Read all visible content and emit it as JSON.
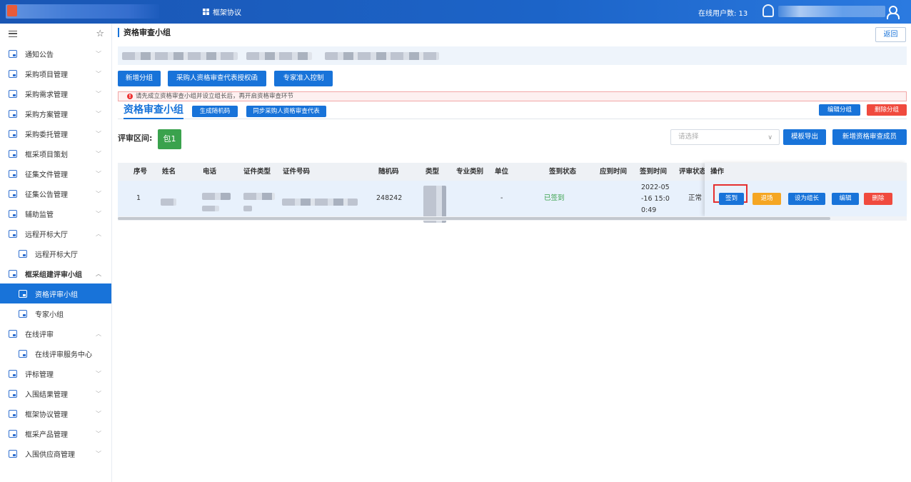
{
  "topbar": {
    "module_label": "框架协议",
    "online_users": "在线用户数: 13"
  },
  "sidebar": {
    "items": [
      {
        "label": "通知公告",
        "icon": "folder-icon",
        "chevron": "﹀"
      },
      {
        "label": "采购项目管理",
        "icon": "folder-icon",
        "chevron": "﹀"
      },
      {
        "label": "采购需求管理",
        "icon": "doc-icon",
        "chevron": "﹀"
      },
      {
        "label": "采购方案管理",
        "icon": "doc-icon",
        "chevron": "﹀"
      },
      {
        "label": "采购委托管理",
        "icon": "doc-icon",
        "chevron": "﹀"
      },
      {
        "label": "框采项目策划",
        "icon": "folder-icon",
        "chevron": "﹀"
      },
      {
        "label": "征集文件管理",
        "icon": "doc-icon",
        "chevron": "﹀"
      },
      {
        "label": "征集公告管理",
        "icon": "doc-icon",
        "chevron": "﹀"
      },
      {
        "label": "辅助监管",
        "icon": "monitor-icon",
        "chevron": "﹀"
      },
      {
        "label": "远程开标大厅",
        "icon": "doc-icon",
        "chevron": "︿"
      },
      {
        "label": "远程开标大厅",
        "icon": "doc-icon",
        "sub": true
      },
      {
        "label": "框采组建评审小组",
        "icon": "group-icon",
        "chevron": "︿",
        "bold": true
      },
      {
        "label": "资格评审小组",
        "icon": "group-icon",
        "sub": true,
        "active": true
      },
      {
        "label": "专家小组",
        "icon": "group-icon",
        "sub": true
      },
      {
        "label": "在线评审",
        "icon": "monitor-icon",
        "chevron": "︿"
      },
      {
        "label": "在线评审服务中心",
        "icon": "monitor-icon",
        "sub": true
      },
      {
        "label": "评标管理",
        "icon": "doc-icon",
        "chevron": "﹀"
      },
      {
        "label": "入围结果管理",
        "icon": "doc-icon",
        "chevron": "﹀"
      },
      {
        "label": "框架协议管理",
        "icon": "flow-icon",
        "chevron": "﹀"
      },
      {
        "label": "框采产品管理",
        "icon": "doc-icon",
        "chevron": "﹀"
      },
      {
        "label": "入围供应商管理",
        "icon": "doc-icon",
        "chevron": "﹀"
      }
    ]
  },
  "page": {
    "title": "资格审查小组",
    "back_label": "返回",
    "buttons": {
      "add_group": "新增分组",
      "authorize": "采购人资格审查代表授权函",
      "expert_access": "专家准入控制"
    },
    "alert": "请先成立资格审查小组并设立组长后，再开启资格审查环节",
    "tab_title": "资格审查小组",
    "gen_code": "生成随机码",
    "sync_rep": "同步采购人资格审查代表",
    "edit_group": "编辑分组",
    "delete_group": "删除分组",
    "range_label": "评审区间:",
    "package": "包1",
    "select_placeholder": "请选择",
    "export_template": "模板导出",
    "add_member": "新增资格审查成员"
  },
  "table": {
    "headers": [
      "序号",
      "姓名",
      "电话",
      "证件类型",
      "证件号码",
      "随机码",
      "类型",
      "专业类别",
      "单位",
      "签到状态",
      "应到时间",
      "签到时间",
      "评审状态",
      "操作"
    ],
    "rows": [
      {
        "index": "1",
        "random_code": "248242",
        "unit": "-",
        "sign_status": "已签到",
        "sign_time_1": "2022-05",
        "sign_time_2": "-16 15:0",
        "sign_time_3": "0:49",
        "review_status": "正常"
      }
    ],
    "actions": {
      "sign_in": "签到",
      "leave": "退场",
      "set_leader": "设为组长",
      "edit": "编辑",
      "delete": "删除"
    }
  },
  "colors": {
    "primary": "#1873d9",
    "danger": "#f04a3e",
    "warning": "#f5a623",
    "success": "#3aa24d",
    "signed": "#3aa24d"
  }
}
